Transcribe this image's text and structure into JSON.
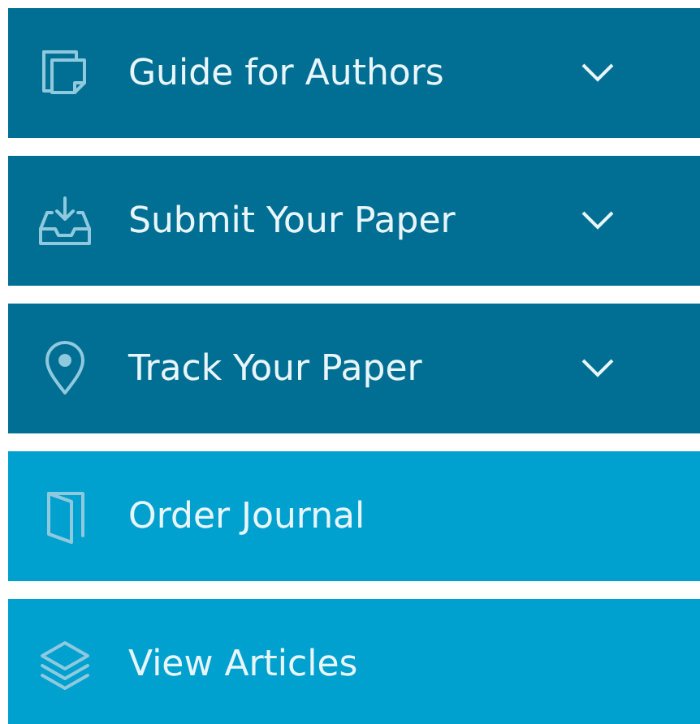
{
  "menu": [
    {
      "kind": "dropdown",
      "label": "Guide for Authors",
      "expanded": false
    },
    {
      "kind": "dropdown",
      "label": "Submit Your Paper",
      "expanded": false
    },
    {
      "kind": "dropdown",
      "label": "Track Your Paper",
      "expanded": false
    },
    {
      "kind": "link",
      "label": "Order Journal"
    },
    {
      "kind": "link",
      "label": "View Articles"
    }
  ]
}
